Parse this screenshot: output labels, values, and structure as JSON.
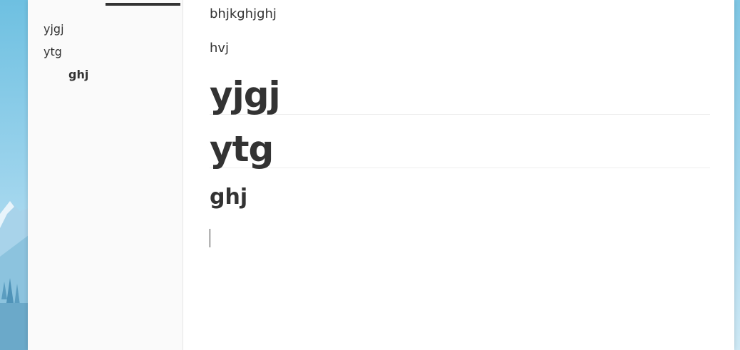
{
  "sidebar": {
    "outline": [
      {
        "label": "yjgj",
        "level": 1
      },
      {
        "label": "ytg",
        "level": 1
      },
      {
        "label": "ghj",
        "level": 3
      }
    ]
  },
  "editor": {
    "paragraph_1": "bhjkghjghj",
    "paragraph_2": "hvj",
    "heading_1a": "yjgj",
    "heading_1b": "ytg",
    "heading_3": "ghj"
  },
  "colors": {
    "text": "#333333",
    "sidebar_bg": "#fafafa",
    "editor_bg": "#ffffff",
    "desktop_sky": "#6fc2e2"
  }
}
